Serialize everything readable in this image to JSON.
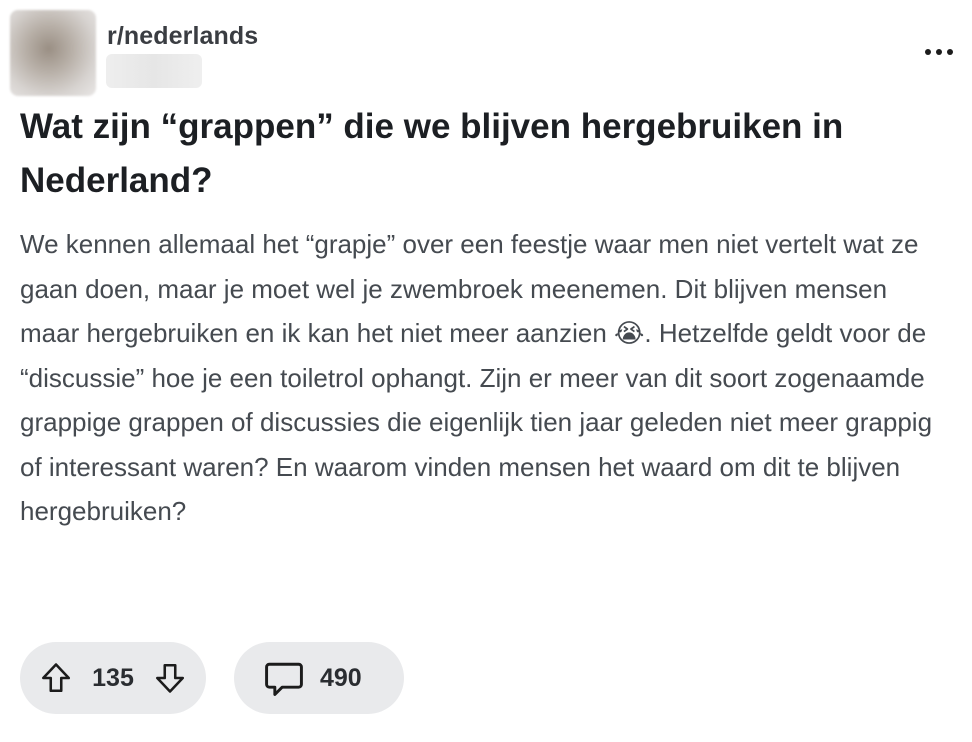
{
  "post": {
    "subreddit": "r/nederlands",
    "title": "Wat zijn “grappen” die we blijven hergebruiken in Nederland?",
    "body": "We kennen allemaal het “grapje” over een feestje waar men niet vertelt wat ze gaan doen, maar je moet wel je zwembroek meenemen. Dit blijven mensen maar hergebruiken en ik kan het niet meer aanzien 😭. Hetzelfde geldt voor de “discussie” hoe je een toiletrol ophangt. Zijn er meer van dit soort zogenaamde grappige grappen of discussies die eigenlijk tien jaar geleden niet meer grappig of interessant waren? En waarom vinden mensen het waard om dit te blijven hergebruiken?"
  },
  "actions": {
    "upvote_icon": "arrow-up-icon",
    "vote_count": "135",
    "downvote_icon": "arrow-down-icon",
    "comment_icon": "speech-bubble-icon",
    "comment_count": "490",
    "more_icon": "more-dots-icon"
  },
  "colors": {
    "pill_background": "#e9eaec",
    "title_text": "#1c1f23",
    "body_text": "#454a50"
  }
}
